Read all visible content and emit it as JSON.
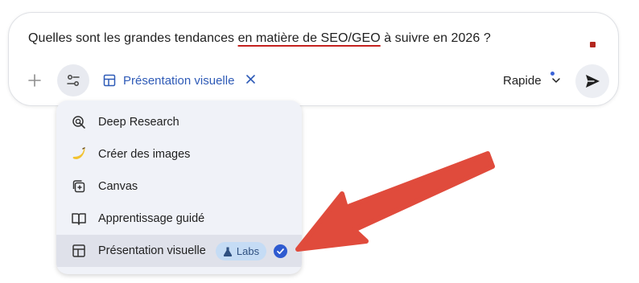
{
  "prompt": {
    "text_before": "Quelles sont les grandes tendances ",
    "text_underlined": "en matière de SEO/GEO",
    "text_after": " à suivre en 2026 ?"
  },
  "toolbar": {
    "add_icon": "plus-icon",
    "tools_icon": "sliders-icon",
    "active_tool_chip": {
      "icon": "layout-icon",
      "label": "Présentation visuelle",
      "close_icon": "close-icon"
    },
    "model_label": "Rapide",
    "model_chevron": "chevron-down-icon",
    "send_icon": "send-icon"
  },
  "menu": {
    "items": [
      {
        "label": "Deep Research",
        "icon": "deep-research-icon"
      },
      {
        "label": "Créer des images",
        "icon": "banana-icon"
      },
      {
        "label": "Canvas",
        "icon": "canvas-icon"
      },
      {
        "label": "Apprentissage guidé",
        "icon": "book-icon"
      },
      {
        "label": "Présentation visuelle",
        "icon": "layout-icon",
        "badge": "Labs",
        "badge_icon": "flask-icon",
        "selected": true
      }
    ]
  },
  "colors": {
    "accent": "#2f5bb7",
    "annotation_arrow": "#e04b3c",
    "menu_bg": "#f0f2f8",
    "selected_bg": "#dfe1ea",
    "labs_badge_bg": "#c5dcf5"
  }
}
